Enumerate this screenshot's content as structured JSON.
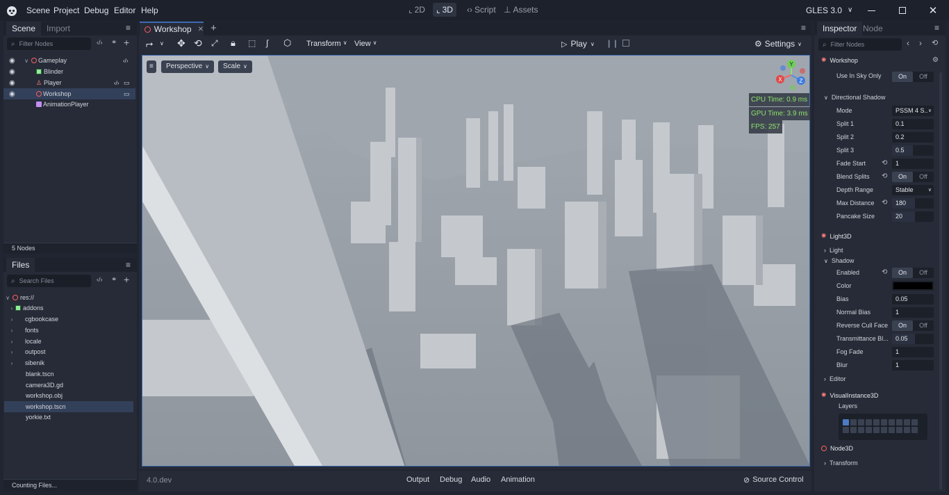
{
  "menubar": {
    "items": [
      "Scene",
      "Project",
      "Debug",
      "Editor",
      "Help"
    ],
    "workspaces": [
      "2D",
      "3D",
      "Script",
      "Assets"
    ],
    "renderer": "GLES 3.0"
  },
  "scene_dock": {
    "tabs": [
      "Scene",
      "Import"
    ],
    "filter_placeholder": "Filter Nodes",
    "nodes": [
      "Gameplay",
      "Blinder",
      "Player",
      "Workshop",
      "AnimationPlayer"
    ],
    "count": "5 Nodes"
  },
  "files_dock": {
    "title": "Files",
    "filter_placeholder": "Search Files",
    "root": "res://",
    "folders": [
      "addons",
      "cgbookcase",
      "fonts",
      "locale",
      "outpost",
      "sibenik"
    ],
    "files": [
      "blank.tscn",
      "camera3D.gd",
      "workshop.obj",
      "workshop.tscn",
      "yorkie.txt"
    ],
    "status": "Counting Files..."
  },
  "editor": {
    "tab": "Workshop",
    "toolbar": {
      "transform": "Transform",
      "view": "View",
      "play": "Play",
      "settings": "Settings"
    },
    "viewport": {
      "perspective": "Perspective",
      "scale": "Scale",
      "cpu": "CPU Time: 0.9 ms",
      "gpu": "GPU Time: 3.9 ms",
      "fps": "FPS: 257",
      "gizmo": {
        "y": "Y",
        "x": "X",
        "z": "Z"
      }
    }
  },
  "bottom": {
    "version": "4.0.dev",
    "panels": [
      "Output",
      "Debug",
      "Audio",
      "Animation"
    ],
    "source_control": "Source Control"
  },
  "inspector": {
    "tabs": [
      "Inspector",
      "Node"
    ],
    "filter_placeholder": "Filter Nodes",
    "object": "Workshop",
    "sky_only_label": "Use In Sky Only",
    "on": "On",
    "off": "Off",
    "dir_shadow": "Directional Shadow",
    "mode_label": "Mode",
    "mode_value": "PSSM 4 S..",
    "split1_label": "Split 1",
    "split1": "0.1",
    "split2_label": "Split 2",
    "split2": "0.2",
    "split3_label": "Split 3",
    "split3": "0.5",
    "fade_label": "Fade Start",
    "fade": "1",
    "blend_label": "Blend Splits",
    "depth_label": "Depth Range",
    "depth": "Stable",
    "maxdist_label": "Max Distance",
    "maxdist": "180",
    "pancake_label": "Pancake Size",
    "pancake": "20",
    "light3d": "Light3D",
    "light": "Light",
    "shadow": "Shadow",
    "enabled_label": "Enabled",
    "color_label": "Color",
    "bias_label": "Bias",
    "bias": "0.05",
    "normal_label": "Normal Bias",
    "normal": "1",
    "reverse_label": "Reverse Cull Face",
    "trans_label": "Transmittance Bl...",
    "trans": "0.05",
    "fog_label": "Fog Fade",
    "fog": "1",
    "blur_label": "Blur",
    "blur": "1",
    "editor": "Editor",
    "visual": "VisualInstance3D",
    "layers": "Layers",
    "node3d": "Node3D",
    "transform": "Transform"
  },
  "colors": {
    "accent": "#3d6ab3",
    "node_red": "#ff5f5f",
    "fps_green": "#8ce26c"
  }
}
